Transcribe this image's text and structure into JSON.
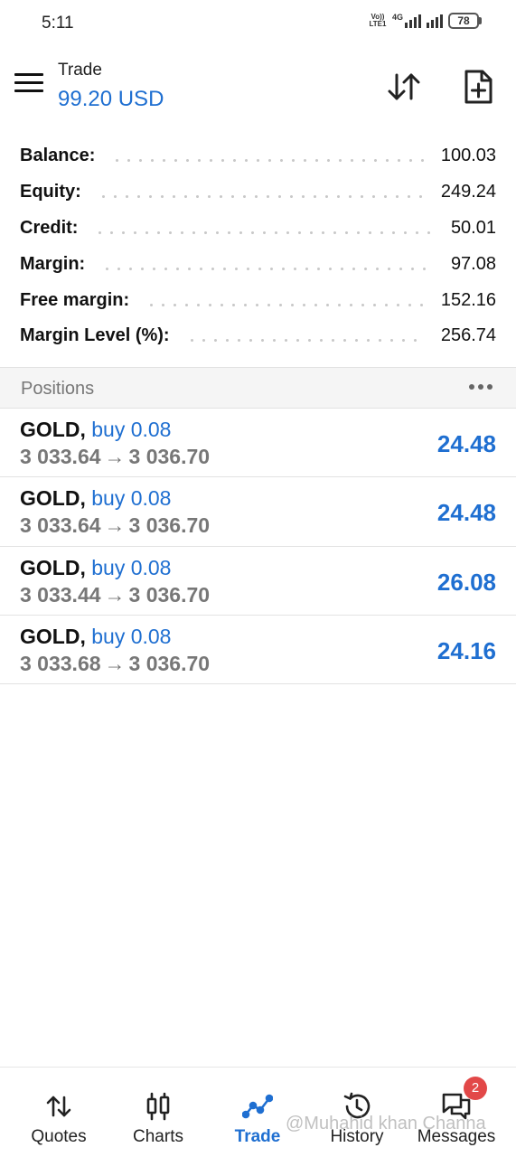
{
  "status_bar": {
    "time": "5:11",
    "volte": "Vo)) LTE1",
    "network": "4G",
    "battery": "78"
  },
  "header": {
    "title": "Trade",
    "balance": "99.20 USD",
    "sort_icon": "sort-arrows-icon",
    "new_order_icon": "new-order-icon"
  },
  "summary": [
    {
      "label": "Balance:",
      "value": "100.03"
    },
    {
      "label": "Equity:",
      "value": "249.24"
    },
    {
      "label": "Credit:",
      "value": "50.01"
    },
    {
      "label": "Margin:",
      "value": "97.08"
    },
    {
      "label": "Free margin:",
      "value": "152.16"
    },
    {
      "label": "Margin Level (%):",
      "value": "256.74"
    }
  ],
  "positions": {
    "title": "Positions",
    "items": [
      {
        "symbol": "GOLD,",
        "side": "buy 0.08",
        "open": "3 033.64",
        "arrow": "→",
        "current": "3 036.70",
        "profit": "24.48"
      },
      {
        "symbol": "GOLD,",
        "side": "buy 0.08",
        "open": "3 033.64",
        "arrow": "→",
        "current": "3 036.70",
        "profit": "24.48"
      },
      {
        "symbol": "GOLD,",
        "side": "buy 0.08",
        "open": "3 033.44",
        "arrow": "→",
        "current": "3 036.70",
        "profit": "26.08"
      },
      {
        "symbol": "GOLD,",
        "side": "buy 0.08",
        "open": "3 033.68",
        "arrow": "→",
        "current": "3 036.70",
        "profit": "24.16"
      }
    ]
  },
  "bottom_nav": {
    "items": [
      {
        "label": "Quotes",
        "icon": "quotes-arrows-icon"
      },
      {
        "label": "Charts",
        "icon": "candlestick-icon"
      },
      {
        "label": "Trade",
        "icon": "trade-line-icon",
        "active": true
      },
      {
        "label": "History",
        "icon": "history-clock-icon"
      },
      {
        "label": "Messages",
        "icon": "messages-icon",
        "badge": "2"
      }
    ]
  },
  "watermark": "@Muhahid khan Channa",
  "colors": {
    "accent": "#1f6fd1",
    "badge": "#e24848",
    "section_bg": "#f5f5f5"
  }
}
